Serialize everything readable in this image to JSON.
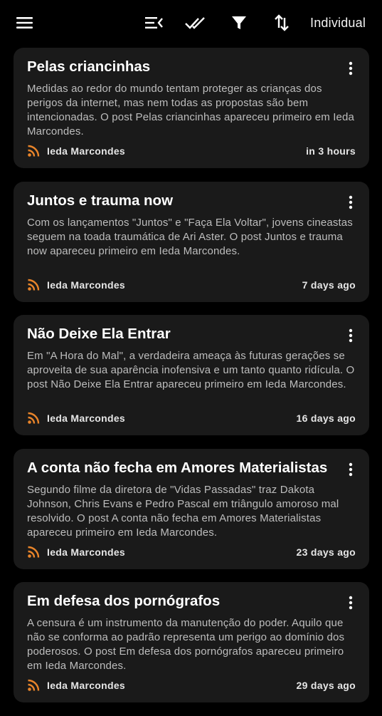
{
  "toolbar": {
    "view_label": "Individual",
    "icons": [
      "menu-icon",
      "collapse-list-icon",
      "mark-all-read-icon",
      "filter-icon",
      "sort-icon"
    ]
  },
  "colors": {
    "background": "#000000",
    "card": "#1a1a1a",
    "rss_accent": "#e8842a"
  },
  "articles": [
    {
      "title": "Pelas criancinhas",
      "description": "Medidas ao redor do mundo tentam proteger as crianças dos perigos da internet, mas nem todas as propostas são bem intencionadas. O post Pelas criancinhas apareceu primeiro em Ieda Marcondes.",
      "source": "Ieda Marcondes",
      "time": "in 3 hours"
    },
    {
      "title": "Juntos e trauma now",
      "description": "Com os lançamentos \"Juntos\" e \"Faça Ela Voltar\", jovens cineastas seguem na toada traumática de Ari Aster. O post Juntos e trauma now apareceu primeiro em Ieda Marcondes.",
      "source": "Ieda Marcondes",
      "time": "7 days ago"
    },
    {
      "title": "Não Deixe Ela Entrar",
      "description": "Em \"A Hora do Mal\", a verdadeira ameaça às futuras gerações se aproveita de sua aparência inofensiva e um tanto quanto ridícula. O post Não Deixe Ela Entrar apareceu primeiro em Ieda Marcondes.",
      "source": "Ieda Marcondes",
      "time": "16 days ago"
    },
    {
      "title": "A conta não fecha em Amores Materialistas",
      "description": "Segundo filme da diretora de \"Vidas Passadas\" traz Dakota Johnson, Chris Evans e Pedro Pascal em triângulo amoroso mal resolvido. O post A conta não fecha em Amores Materialistas apareceu primeiro em Ieda Marcondes.",
      "source": "Ieda Marcondes",
      "time": "23 days ago"
    },
    {
      "title": "Em defesa dos pornógrafos",
      "description": "A censura é um instrumento da manutenção do poder. Aquilo que não se conforma ao padrão representa um perigo ao domínio dos poderosos. O post Em defesa dos pornógrafos apareceu primeiro em Ieda Marcondes.",
      "source": "Ieda Marcondes",
      "time": "29 days ago"
    }
  ]
}
